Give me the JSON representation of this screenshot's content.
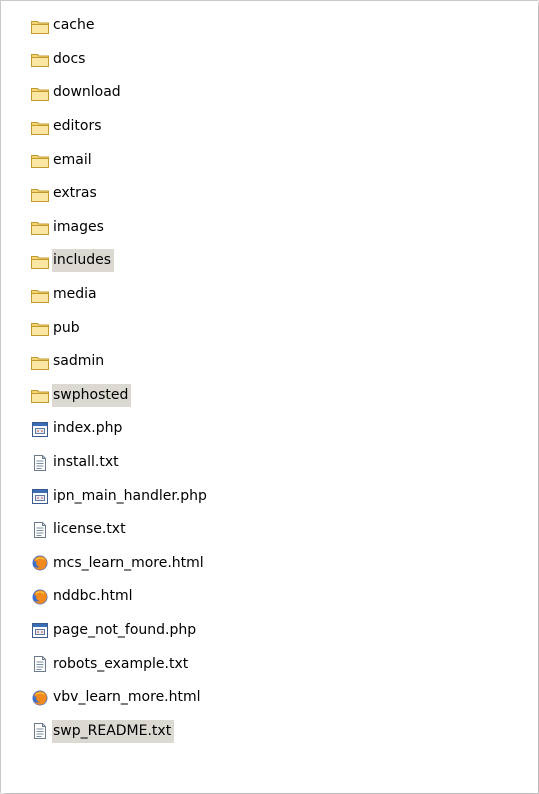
{
  "files": [
    {
      "name": "cache",
      "type": "folder",
      "highlighted": false
    },
    {
      "name": "docs",
      "type": "folder",
      "highlighted": false
    },
    {
      "name": "download",
      "type": "folder",
      "highlighted": false
    },
    {
      "name": "editors",
      "type": "folder",
      "highlighted": false
    },
    {
      "name": "email",
      "type": "folder",
      "highlighted": false
    },
    {
      "name": "extras",
      "type": "folder",
      "highlighted": false
    },
    {
      "name": "images",
      "type": "folder",
      "highlighted": false
    },
    {
      "name": "includes",
      "type": "folder",
      "highlighted": true
    },
    {
      "name": "media",
      "type": "folder",
      "highlighted": false
    },
    {
      "name": "pub",
      "type": "folder",
      "highlighted": false
    },
    {
      "name": "sadmin",
      "type": "folder",
      "highlighted": false
    },
    {
      "name": "swphosted",
      "type": "folder",
      "highlighted": true
    },
    {
      "name": "index.php",
      "type": "php",
      "highlighted": false
    },
    {
      "name": "install.txt",
      "type": "txt",
      "highlighted": false
    },
    {
      "name": "ipn_main_handler.php",
      "type": "php",
      "highlighted": false
    },
    {
      "name": "license.txt",
      "type": "txt",
      "highlighted": false
    },
    {
      "name": "mcs_learn_more.html",
      "type": "html",
      "highlighted": false
    },
    {
      "name": "nddbc.html",
      "type": "html",
      "highlighted": false
    },
    {
      "name": "page_not_found.php",
      "type": "php",
      "highlighted": false
    },
    {
      "name": "robots_example.txt",
      "type": "txt",
      "highlighted": false
    },
    {
      "name": "vbv_learn_more.html",
      "type": "html",
      "highlighted": false
    },
    {
      "name": "swp_README.txt",
      "type": "txt",
      "highlighted": true
    }
  ],
  "icons": {
    "folder": "folder-icon",
    "php": "php-file-icon",
    "txt": "text-file-icon",
    "html": "firefox-html-icon"
  },
  "colors": {
    "highlight": "#dcd9d2",
    "folder_fill": "#fbe7a3",
    "folder_stroke": "#c49a2c"
  }
}
